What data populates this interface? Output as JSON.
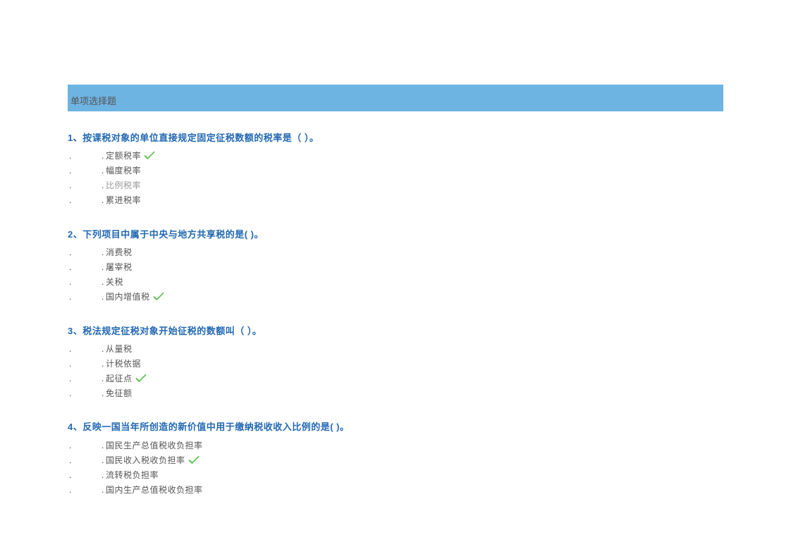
{
  "section_title": "单项选择题",
  "questions": [
    {
      "number": "1",
      "sep": "、",
      "text": "按课税对象的单位直接规定固定征税数额的税率是（ ）。",
      "options": [
        {
          "label": "定额税率",
          "correct": true,
          "faded": false
        },
        {
          "label": "幅度税率",
          "correct": false,
          "faded": false
        },
        {
          "label": "比例税率",
          "correct": false,
          "faded": true
        },
        {
          "label": "累进税率",
          "correct": false,
          "faded": false
        }
      ]
    },
    {
      "number": "2",
      "sep": "、",
      "text": "下列项目中属于中央与地方共享税的是( )。",
      "options": [
        {
          "label": "消费税",
          "correct": false,
          "faded": false
        },
        {
          "label": "屠宰税",
          "correct": false,
          "faded": false
        },
        {
          "label": "关税",
          "correct": false,
          "faded": false
        },
        {
          "label": "国内增值税",
          "correct": true,
          "faded": false
        }
      ]
    },
    {
      "number": "3",
      "sep": "、",
      "text": "税法规定征税对象开始征税的数额叫（ ）。",
      "options": [
        {
          "label": "从量税",
          "correct": false,
          "faded": false
        },
        {
          "label": "计税依据",
          "correct": false,
          "faded": false
        },
        {
          "label": "起征点",
          "correct": true,
          "faded": false
        },
        {
          "label": "免征额",
          "correct": false,
          "faded": false
        }
      ]
    },
    {
      "number": "4",
      "sep": "、",
      "text": "反映一国当年所创造的新价值中用于缴纳税收收入比例的是( )。",
      "options": [
        {
          "label": "国民生产总值税收负担率",
          "correct": false,
          "faded": false
        },
        {
          "label": "国民收入税收负担率",
          "correct": true,
          "faded": false
        },
        {
          "label": "流转税负担率",
          "correct": false,
          "faded": false
        },
        {
          "label": "国内生产总值税收负担率",
          "correct": false,
          "faded": false
        }
      ]
    }
  ]
}
